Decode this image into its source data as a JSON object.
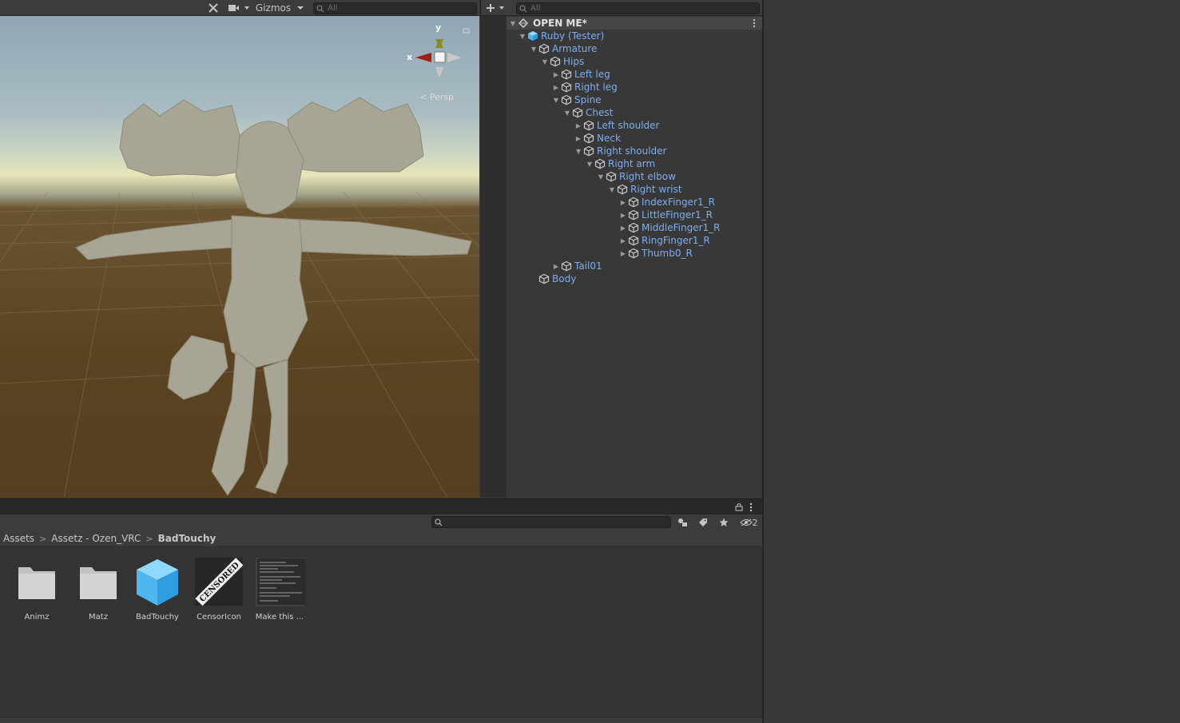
{
  "scene": {
    "toolbar": {
      "gizmos_label": "Gizmos",
      "search_placeholder": "All"
    },
    "axis_y": "y",
    "axis_x": "x",
    "persp_label": "< Persp"
  },
  "hierarchy": {
    "search_placeholder": "All",
    "scene_name": "OPEN ME*",
    "items": [
      {
        "label": "Ruby (Tester)"
      },
      {
        "label": "Armature"
      },
      {
        "label": "Hips"
      },
      {
        "label": "Left leg"
      },
      {
        "label": "Right leg"
      },
      {
        "label": "Spine"
      },
      {
        "label": "Chest"
      },
      {
        "label": "Left shoulder"
      },
      {
        "label": "Neck"
      },
      {
        "label": "Right shoulder"
      },
      {
        "label": "Right arm"
      },
      {
        "label": "Right elbow"
      },
      {
        "label": "Right wrist"
      },
      {
        "label": "IndexFinger1_R"
      },
      {
        "label": "LittleFinger1_R"
      },
      {
        "label": "MiddleFinger1_R"
      },
      {
        "label": "RingFinger1_R"
      },
      {
        "label": "Thumb0_R"
      },
      {
        "label": "Tail01"
      },
      {
        "label": "Body"
      }
    ]
  },
  "project": {
    "hidden_count": "2",
    "breadcrumb": [
      "Assets",
      "Assetz - Ozen_VRC",
      "BadTouchy"
    ],
    "assets": [
      {
        "label": "Animz",
        "icon": "folder-icon"
      },
      {
        "label": "Matz",
        "icon": "folder-icon"
      },
      {
        "label": "BadTouchy",
        "icon": "prefab-cube-icon"
      },
      {
        "label": "CensorIcon",
        "icon": "censored-texture-icon",
        "stamp": "CENSORED"
      },
      {
        "label": "Make this ...",
        "icon": "screenshot-texture-icon"
      }
    ]
  },
  "colors": {
    "accent_link": "#7eaeee",
    "panel": "#383838",
    "dark": "#232323"
  }
}
